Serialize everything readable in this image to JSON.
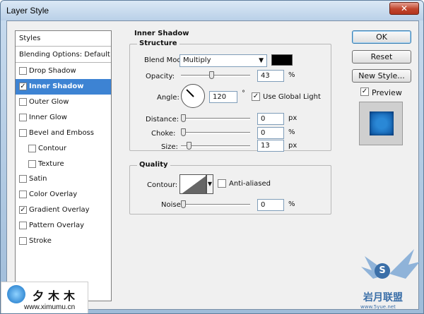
{
  "window": {
    "title": "Layer Style",
    "close": "✕"
  },
  "styles_panel": {
    "header": "Styles",
    "blending": "Blending Options: Default",
    "items": [
      {
        "label": "Drop Shadow",
        "checked": false
      },
      {
        "label": "Inner Shadow",
        "checked": true,
        "selected": true
      },
      {
        "label": "Outer Glow",
        "checked": false
      },
      {
        "label": "Inner Glow",
        "checked": false
      },
      {
        "label": "Bevel and Emboss",
        "checked": false
      },
      {
        "label": "Contour",
        "checked": false,
        "indent": true
      },
      {
        "label": "Texture",
        "checked": false,
        "indent": true
      },
      {
        "label": "Satin",
        "checked": false
      },
      {
        "label": "Color Overlay",
        "checked": false
      },
      {
        "label": "Gradient Overlay",
        "checked": true
      },
      {
        "label": "Pattern Overlay",
        "checked": false
      },
      {
        "label": "Stroke",
        "checked": false
      }
    ]
  },
  "inner_shadow": {
    "title": "Inner Shadow",
    "structure": {
      "title": "Structure",
      "blend_mode_label": "Blend Mode:",
      "blend_mode_value": "Multiply",
      "color": "#000000",
      "opacity_label": "Opacity:",
      "opacity_value": "43",
      "opacity_unit": "%",
      "angle_label": "Angle:",
      "angle_value": "120",
      "angle_unit": "°",
      "use_global_light_label": "Use Global Light",
      "use_global_light": true,
      "distance_label": "Distance:",
      "distance_value": "0",
      "distance_unit": "px",
      "choke_label": "Choke:",
      "choke_value": "0",
      "choke_unit": "%",
      "size_label": "Size:",
      "size_value": "13",
      "size_unit": "px"
    },
    "quality": {
      "title": "Quality",
      "contour_label": "Contour:",
      "anti_aliased_label": "Anti-aliased",
      "anti_aliased": false,
      "noise_label": "Noise:",
      "noise_value": "0",
      "noise_unit": "%"
    }
  },
  "buttons": {
    "ok": "OK",
    "reset": "Reset",
    "new_style": "New Style...",
    "preview_label": "Preview",
    "preview_checked": true
  },
  "check_mark": "✓",
  "watermark": {
    "left_text": "夕木木",
    "left_url": "www.ximumu.cn",
    "right_text": "岩月联盟",
    "right_url": "www.5yue.net",
    "right_mark": "S"
  }
}
